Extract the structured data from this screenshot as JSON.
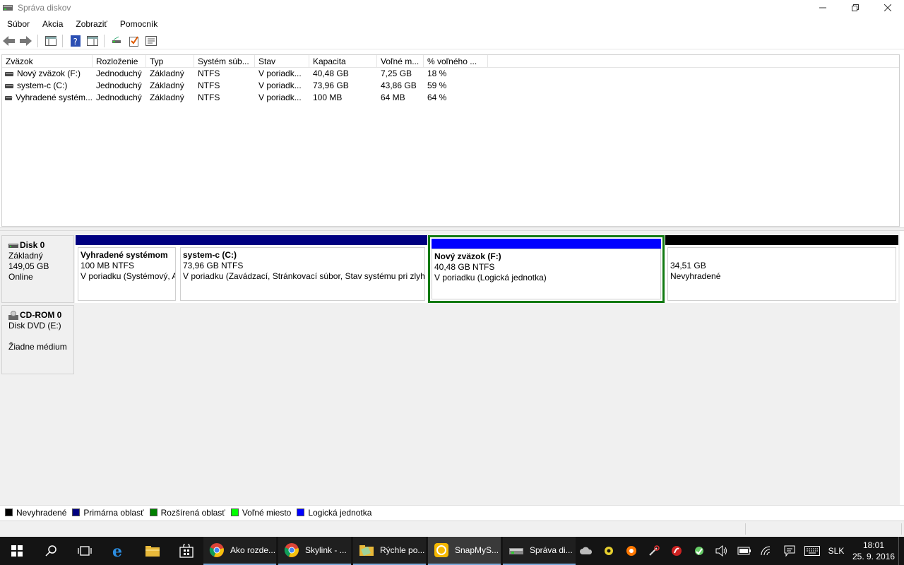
{
  "window": {
    "title": "Správa diskov"
  },
  "menu": [
    "Súbor",
    "Akcia",
    "Zobraziť",
    "Pomocník"
  ],
  "volume_list": {
    "columns": [
      "Zväzok",
      "Rozloženie",
      "Typ",
      "Systém súb...",
      "Stav",
      "Kapacita",
      "Voľné m...",
      "% voľného ..."
    ],
    "rows": [
      [
        "Nový zväzok (F:)",
        "Jednoduchý",
        "Základný",
        "NTFS",
        "V poriadk...",
        "40,48 GB",
        "7,25 GB",
        "18 %"
      ],
      [
        "system-c (C:)",
        "Jednoduchý",
        "Základný",
        "NTFS",
        "V poriadk...",
        "73,96 GB",
        "43,86 GB",
        "59 %"
      ],
      [
        "Vyhradené systém...",
        "Jednoduchý",
        "Základný",
        "NTFS",
        "V poriadk...",
        "100 MB",
        "64 MB",
        "64 %"
      ]
    ]
  },
  "disks": [
    {
      "name": "Disk 0",
      "type": "Základný",
      "size": "149,05 GB",
      "status": "Online",
      "partitions": [
        {
          "name": "Vyhradené systémom",
          "size": "100 MB NTFS",
          "status": "V poriadku (Systémový, Aktívny, Primárna oblasť)",
          "color": "#000080"
        },
        {
          "name": "system-c  (C:)",
          "size": "73,96 GB NTFS",
          "status": "V poriadku (Zavádzací, Stránkovací súbor, Stav systému pri zlyhaní, Primárna oblasť)",
          "color": "#000080"
        },
        {
          "name": "Nový zväzok  (F:)",
          "size": "40,48 GB NTFS",
          "status": "V poriadku (Logická jednotka)",
          "color": "#0000ff"
        },
        {
          "name": "",
          "size": "34,51 GB",
          "status": "Nevyhradené",
          "color": "#000000"
        }
      ]
    },
    {
      "name": "CD-ROM 0",
      "type": "Disk DVD (E:)",
      "size": "",
      "status": "Žiadne médium"
    }
  ],
  "legend": [
    {
      "label": "Nevyhradené",
      "color": "#000000"
    },
    {
      "label": "Primárna oblasť",
      "color": "#000080"
    },
    {
      "label": "Rozšírená oblasť",
      "color": "#008000"
    },
    {
      "label": "Voľné miesto",
      "color": "#00ff00"
    },
    {
      "label": "Logická jednotka",
      "color": "#0000ff"
    }
  ],
  "taskbar": {
    "apps": [
      {
        "label": "Ako rozde...",
        "icon": "chrome-icon"
      },
      {
        "label": "Skylink - ...",
        "icon": "chrome-icon"
      },
      {
        "label": "Rýchle po...",
        "icon": "folder-icon"
      },
      {
        "label": "SnapMyS...",
        "icon": "snapmyscreen-icon"
      },
      {
        "label": "Správa di...",
        "icon": "disk-management-icon"
      }
    ],
    "language": "SLK",
    "time": "18:01",
    "date": "25. 9. 2016"
  }
}
